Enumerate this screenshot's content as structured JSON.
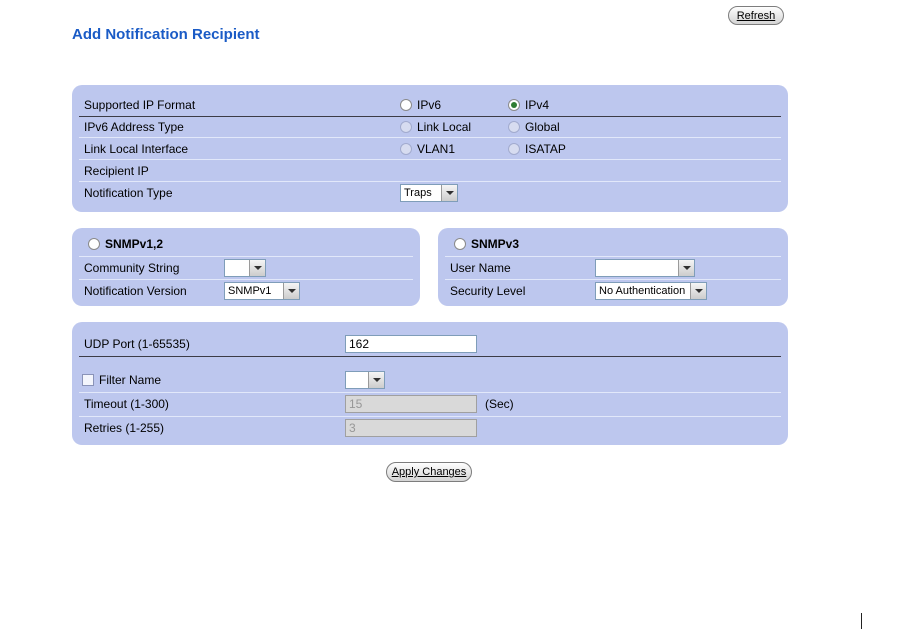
{
  "colors": {
    "panel_background": "#bdc7ee",
    "title_text": "#1a5bc6",
    "selected_radio_dot": "#2f7d32",
    "button_face": "#d4d4d4",
    "input_border": "#7f9db9"
  },
  "header": {
    "refresh_button": "Refresh",
    "page_title": "Add Notification Recipient"
  },
  "ip_panel": {
    "format": {
      "label": "Supported IP Format",
      "options": [
        "IPv6",
        "IPv4"
      ],
      "selected": "IPv4"
    },
    "address_type": {
      "label": "IPv6 Address Type",
      "options": [
        "Link Local",
        "Global"
      ],
      "selected": "",
      "disabled": true
    },
    "link_local_interface": {
      "label": "Link Local Interface",
      "options": [
        "VLAN1",
        "ISATAP"
      ],
      "selected": "",
      "disabled": true
    },
    "recipient_ip": {
      "label": "Recipient IP"
    },
    "notification_type": {
      "label": "Notification Type",
      "value": "Traps"
    }
  },
  "snmp_v12_panel": {
    "title": "SNMPv1,2",
    "selected": false,
    "community_string": {
      "label": "Community String",
      "value": ""
    },
    "notification_version": {
      "label": "Notification Version",
      "value": "SNMPv1"
    }
  },
  "snmp_v3_panel": {
    "title": "SNMPv3",
    "selected": false,
    "user_name": {
      "label": "User Name",
      "value": ""
    },
    "security_level": {
      "label": "Security Level",
      "value": "No Authentication"
    }
  },
  "udp_panel": {
    "udp_port": {
      "label": "UDP Port (1-65535)",
      "value": "162"
    },
    "filter_name": {
      "label": "Filter Name",
      "checked": false,
      "value": ""
    },
    "timeout": {
      "label": "Timeout (1-300)",
      "value": "15",
      "unit": "(Sec)",
      "disabled": true
    },
    "retries": {
      "label": "Retries (1-255)",
      "value": "3",
      "disabled": true
    }
  },
  "footer": {
    "apply_button": "Apply Changes"
  }
}
